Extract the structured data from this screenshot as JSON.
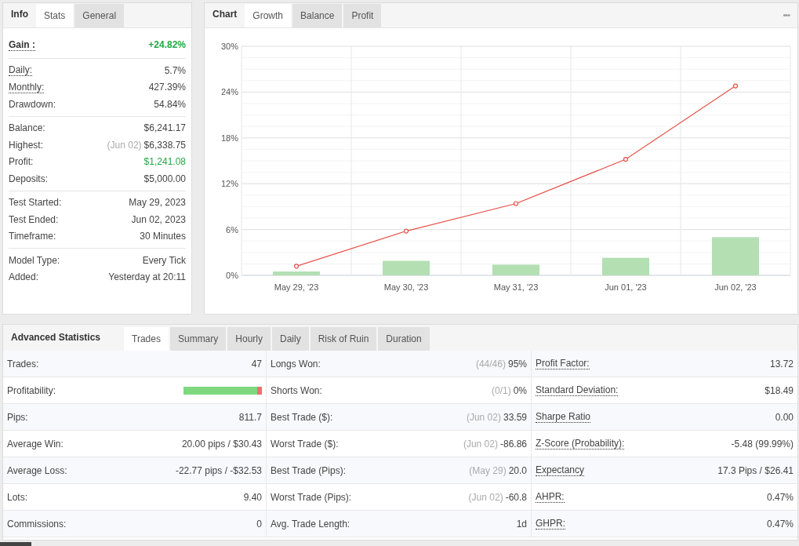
{
  "info_panel": {
    "title": "Info",
    "tabs": [
      {
        "label": "Stats",
        "selected": true
      },
      {
        "label": "General",
        "selected": false
      }
    ],
    "groups": [
      {
        "rows": [
          {
            "label": "Gain :",
            "value": "+24.82%",
            "headline": true,
            "tooltip": true,
            "positive": true
          }
        ]
      },
      {
        "rows": [
          {
            "label": "Daily:",
            "value": "5.7%",
            "headline": false,
            "tooltip": true,
            "positive": false
          },
          {
            "label": "Monthly:",
            "value": "427.39%",
            "headline": false,
            "tooltip": true,
            "positive": false
          },
          {
            "label": "Drawdown:",
            "value": "54.84%",
            "headline": false,
            "tooltip": false,
            "positive": false
          }
        ]
      },
      {
        "rows": [
          {
            "label": "Balance:",
            "value": "$6,241.17",
            "headline": false,
            "tooltip": false,
            "positive": false
          },
          {
            "label": "Highest:",
            "note": "(Jun 02)",
            "value": "$6,338.75",
            "headline": false,
            "tooltip": false,
            "positive": false
          },
          {
            "label": "Profit:",
            "value": "$1,241.08",
            "headline": false,
            "tooltip": false,
            "positive": true
          },
          {
            "label": "Deposits:",
            "value": "$5,000.00",
            "headline": false,
            "tooltip": false,
            "positive": false
          }
        ]
      },
      {
        "rows": [
          {
            "label": "Test Started:",
            "value": "May 29, 2023",
            "headline": false,
            "tooltip": false,
            "positive": false
          },
          {
            "label": "Test Ended:",
            "value": "Jun 02, 2023",
            "headline": false,
            "tooltip": false,
            "positive": false
          },
          {
            "label": "Timeframe:",
            "value": "30 Minutes",
            "headline": false,
            "tooltip": false,
            "positive": false
          }
        ]
      },
      {
        "rows": [
          {
            "label": "Model Type:",
            "value": "Every Tick",
            "headline": false,
            "tooltip": false,
            "positive": false
          },
          {
            "label": "Added:",
            "value": "Yesterday at 20:11",
            "headline": false,
            "tooltip": false,
            "positive": false
          }
        ]
      }
    ]
  },
  "chart_panel": {
    "title": "Chart",
    "tabs": [
      {
        "label": "Growth",
        "selected": true
      },
      {
        "label": "Balance",
        "selected": false
      },
      {
        "label": "Profit",
        "selected": false
      }
    ],
    "menu": "•••",
    "chart_data": {
      "type": "bar",
      "categories": [
        "May 29, '23",
        "May 30, '23",
        "May 31, '23",
        "Jun 01, '23",
        "Jun 02, '23"
      ],
      "ylim": [
        0,
        30
      ],
      "grid": true,
      "yticks": [
        {
          "value": 0,
          "label": "0%"
        },
        {
          "value": 6,
          "label": "6%"
        },
        {
          "value": 12,
          "label": "12%"
        },
        {
          "value": 18,
          "label": "18%"
        },
        {
          "value": 24,
          "label": "24%"
        },
        {
          "value": 30,
          "label": "30%"
        }
      ],
      "series": [
        {
          "type": "bar",
          "color": "#b3dfb3",
          "values": [
            0.5,
            1.9,
            1.4,
            2.3,
            5.0
          ]
        },
        {
          "type": "line",
          "color": "#e5534b",
          "marker": "circle",
          "values": [
            1.2,
            5.8,
            9.4,
            15.2,
            24.8
          ]
        }
      ]
    }
  },
  "advanced_statistics": {
    "title": "Advanced Statistics",
    "tabs": [
      {
        "label": "Trades",
        "selected": true
      },
      {
        "label": "Summary",
        "selected": false
      },
      {
        "label": "Hourly",
        "selected": false
      },
      {
        "label": "Daily",
        "selected": false
      },
      {
        "label": "Risk of Ruin",
        "selected": false
      },
      {
        "label": "Duration",
        "selected": false
      }
    ],
    "rows": [
      {
        "label_1": "Trades:",
        "value_1": "47",
        "label_2": "Longs Won:",
        "note_2": "(44/46)",
        "value_2": "95%",
        "label_3": "Profit Factor:",
        "value_3": "13.72"
      },
      {
        "label_1": "Profitability:",
        "level": 0.94,
        "label_2": "Shorts Won:",
        "note_2": "(0/1)",
        "value_2": "0%",
        "label_3": "Standard Deviation:",
        "value_3": "$18.49"
      },
      {
        "label_1": "Pips:",
        "value_1": "811.7",
        "label_2": "Best Trade ($):",
        "note_2": "(Jun 02)",
        "value_2": "33.59",
        "label_3": "Sharpe Ratio",
        "value_3": "0.00"
      },
      {
        "label_1": "Average Win:",
        "value_1": "20.00 pips / $30.43",
        "label_2": "Worst Trade ($):",
        "note_2": "(Jun 02)",
        "value_2": "-86.86",
        "label_3": "Z-Score (Probability):",
        "value_3": "-5.48 (99.99%)"
      },
      {
        "label_1": "Average Loss:",
        "value_1": "-22.77 pips / -$32.53",
        "label_2": "Best Trade (Pips):",
        "note_2": "(May 29)",
        "value_2": "20.0",
        "label_3": "Expectancy",
        "value_3": "17.3 Pips / $26.41"
      },
      {
        "label_1": "Lots:",
        "value_1": "9.40",
        "label_2": "Worst Trade (Pips):",
        "note_2": "(Jun 02)",
        "value_2": "-60.8",
        "label_3": "AHPR:",
        "value_3": "0.47%"
      },
      {
        "label_1": "Commissions:",
        "value_1": "0",
        "label_2": "Avg. Trade Length:",
        "value_2": "1d",
        "label_3": "GHPR:",
        "value_3": "0.47%"
      }
    ]
  }
}
